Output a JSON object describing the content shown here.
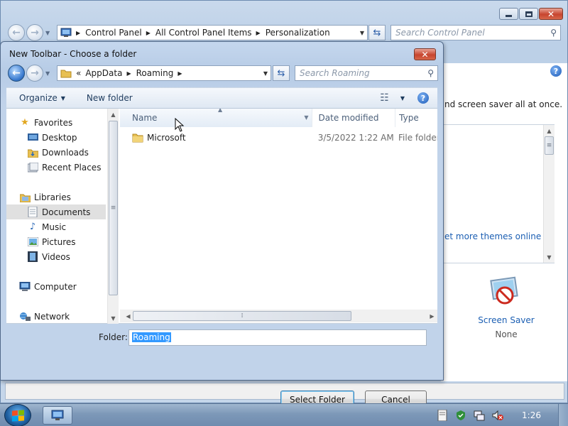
{
  "cp_window": {
    "breadcrumbs": [
      "Control Panel",
      "All Control Panel Items",
      "Personalization"
    ],
    "search_placeholder": "Search Control Panel",
    "description": "nd screen saver all at once.",
    "themes_link": "et more themes online",
    "screen_saver": {
      "label": "Screen Saver",
      "value": "None"
    }
  },
  "dialog": {
    "title": "New Toolbar - Choose a folder",
    "address": {
      "overflow": "«",
      "crumbs": [
        "AppData",
        "Roaming"
      ]
    },
    "search_placeholder": "Search Roaming",
    "toolbar": {
      "organize": "Organize",
      "new_folder": "New folder"
    },
    "nav": {
      "favorites": "Favorites",
      "desktop": "Desktop",
      "downloads": "Downloads",
      "recent_places": "Recent Places",
      "libraries": "Libraries",
      "documents": "Documents",
      "music": "Music",
      "pictures": "Pictures",
      "videos": "Videos",
      "computer": "Computer",
      "network": "Network"
    },
    "columns": {
      "name": "Name",
      "date": "Date modified",
      "type": "Type"
    },
    "files": [
      {
        "name": "Microsoft",
        "date": "3/5/2022 1:22 AM",
        "type": "File folder"
      }
    ],
    "folder_label": "Folder:",
    "folder_value": "Roaming",
    "select_button": "Select Folder",
    "cancel_button": "Cancel"
  },
  "taskbar": {
    "clock": "1:26"
  },
  "colors": {
    "accent": "#3399ff",
    "link": "#1c5fb3",
    "close": "#c7452f"
  }
}
